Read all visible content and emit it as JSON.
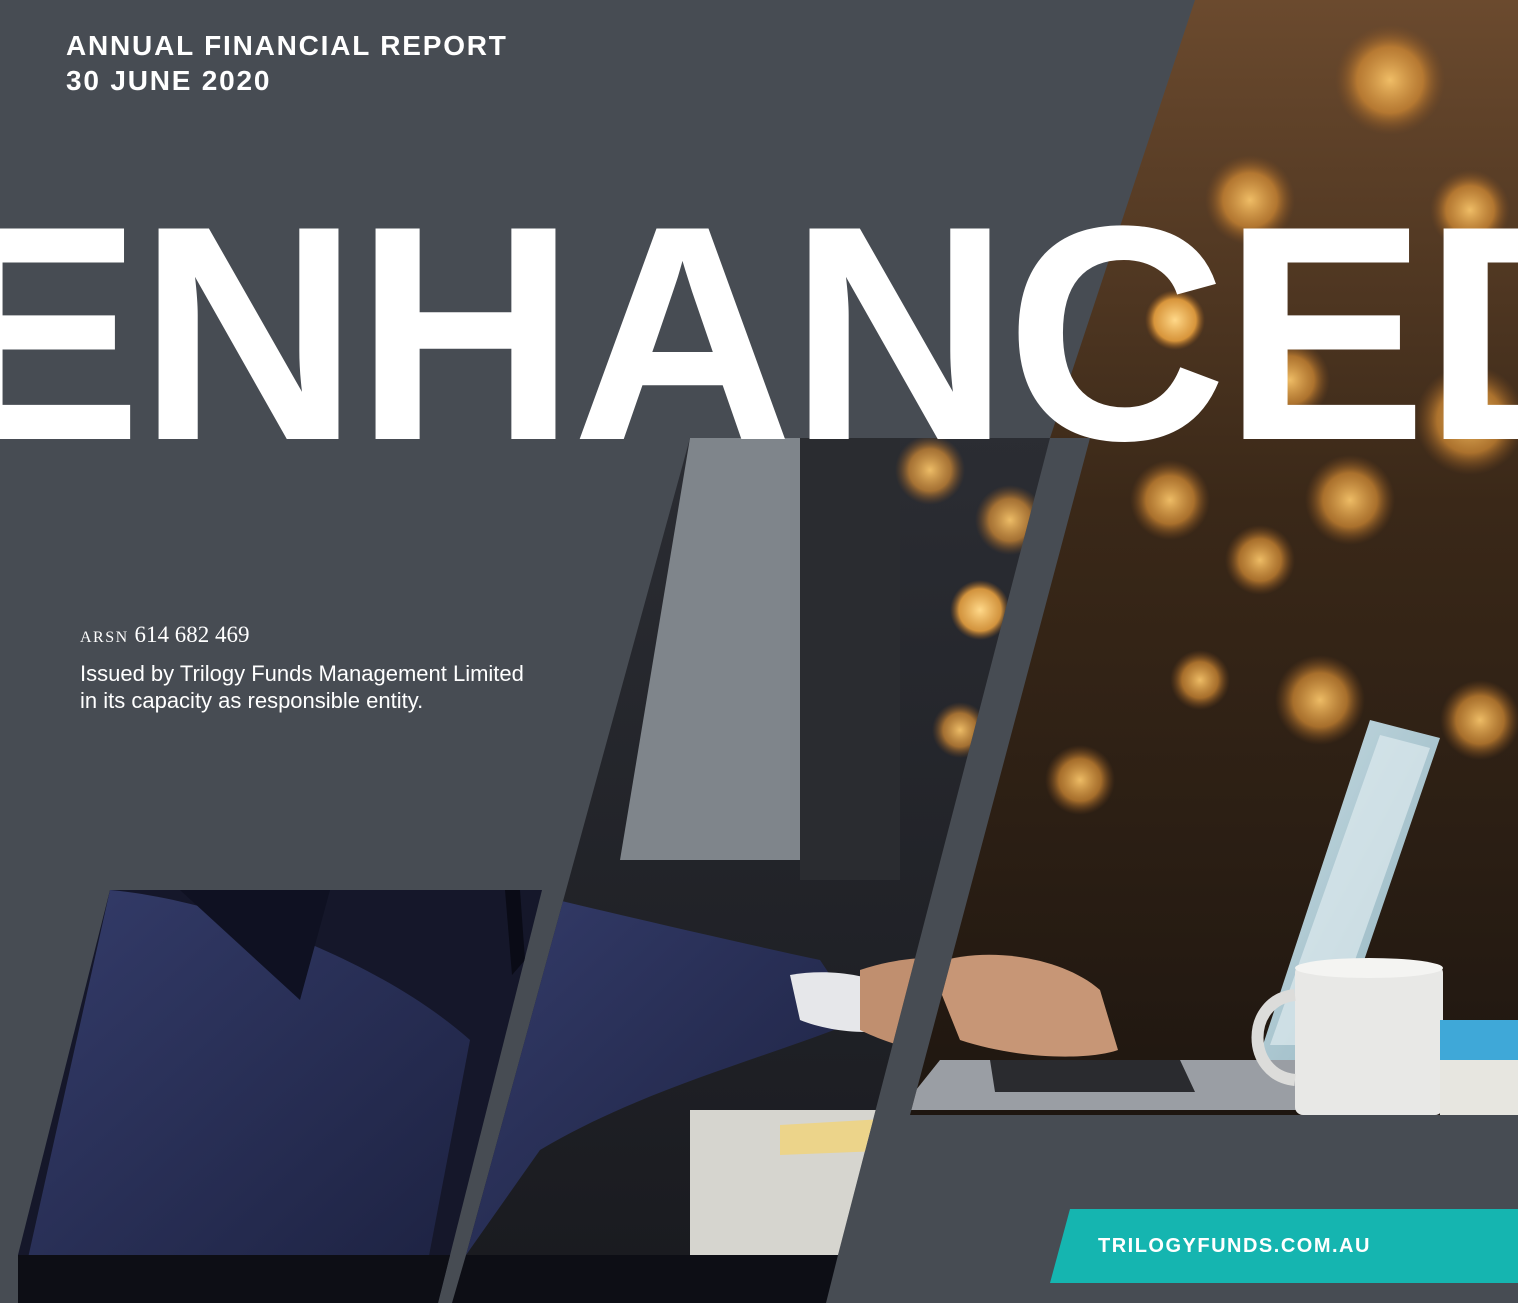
{
  "report": {
    "line1": "ANNUAL FINANCIAL REPORT",
    "line2": "30 JUNE 2020"
  },
  "headline": "ENHANCED",
  "arsn": {
    "label": "ARSN",
    "number": "614 682 469"
  },
  "issued": {
    "line1": "Issued by Trilogy Funds Management Limited",
    "line2": "in its capacity as responsible entity."
  },
  "website": "TRILOGYFUNDS.COM.AU",
  "colors": {
    "background": "#474c53",
    "accent": "#15b5b0",
    "text": "#ffffff"
  }
}
